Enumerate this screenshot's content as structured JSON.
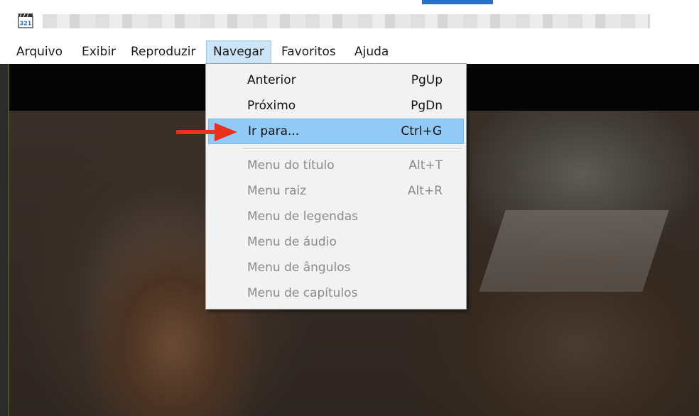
{
  "app": {
    "icon": "media-player-classic-icon",
    "icon_digits": "321"
  },
  "menubar": {
    "items": [
      {
        "label": "Arquivo"
      },
      {
        "label": "Exibir"
      },
      {
        "label": "Reproduzir"
      },
      {
        "label": "Navegar",
        "active": true
      },
      {
        "label": "Favoritos"
      },
      {
        "label": "Ajuda"
      }
    ]
  },
  "navegar_menu": {
    "items": [
      {
        "label": "Anterior",
        "shortcut": "PgUp",
        "enabled": true
      },
      {
        "label": "Próximo",
        "shortcut": "PgDn",
        "enabled": true
      },
      {
        "label": "Ir para...",
        "shortcut": "Ctrl+G",
        "enabled": true,
        "highlighted": true
      },
      {
        "label": "Menu do título",
        "shortcut": "Alt+T",
        "enabled": false
      },
      {
        "label": "Menu raiz",
        "shortcut": "Alt+R",
        "enabled": false
      },
      {
        "label": "Menu de legendas",
        "shortcut": "",
        "enabled": false
      },
      {
        "label": "Menu de áudio",
        "shortcut": "",
        "enabled": false
      },
      {
        "label": "Menu de ângulos",
        "shortcut": "",
        "enabled": false
      },
      {
        "label": "Menu de capítulos",
        "shortcut": "",
        "enabled": false
      }
    ]
  },
  "annotation": {
    "arrow_color": "#e8321e",
    "points_to": "Ir para..."
  },
  "colors": {
    "menu_highlight": "#91c9f7",
    "menubar_active": "#cce4f7",
    "disabled_text": "#8a8a8a"
  }
}
